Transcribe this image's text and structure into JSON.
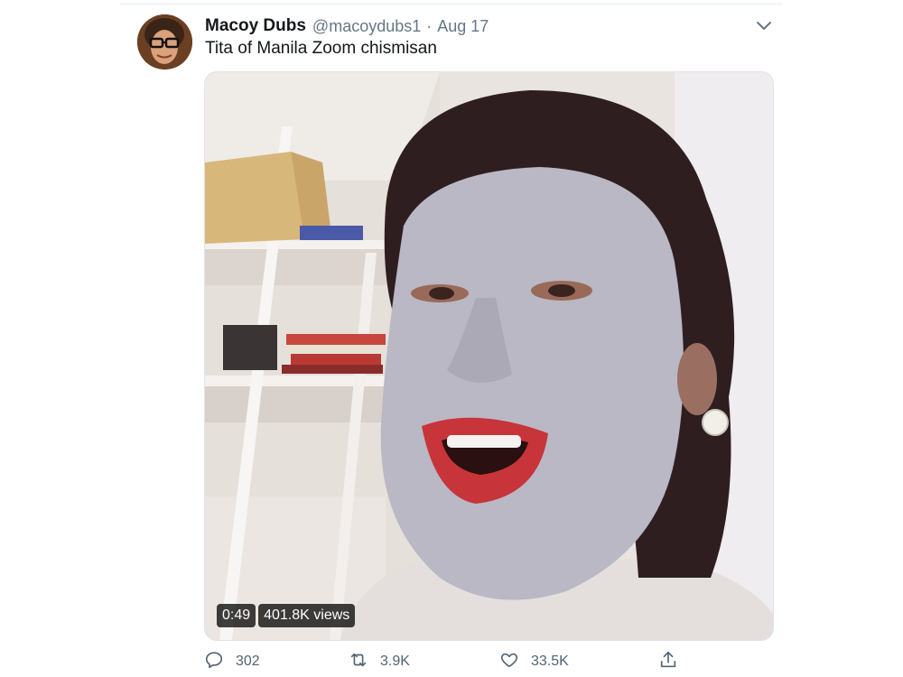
{
  "tweet": {
    "author_name": "Macoy Dubs",
    "handle": "@macoydubs1",
    "separator": "·",
    "date": "Aug 17",
    "text": "Tita of Manila Zoom chismisan"
  },
  "media": {
    "duration": "0:49",
    "views": "401.8K views"
  },
  "actions": {
    "replies": "302",
    "retweets": "3.9K",
    "likes": "33.5K"
  },
  "icons": {
    "reply": "reply-icon",
    "retweet": "retweet-icon",
    "like": "heart-icon",
    "share": "share-icon",
    "more": "chevron-down-icon"
  },
  "colors": {
    "secondary_text": "#657786",
    "action_text": "#536471",
    "divider": "#e6ecf0"
  }
}
